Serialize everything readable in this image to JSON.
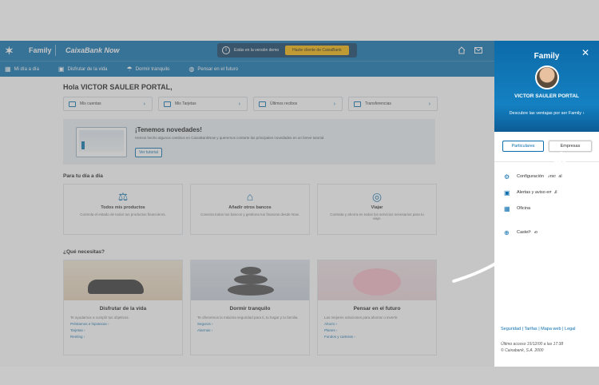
{
  "topbar": {
    "brand_family": "Family",
    "brand_product": "CaixaBank Now",
    "demo_text": "Estás en la versión demo",
    "demo_button": "Hazte cliente de CaixaBank"
  },
  "nav": [
    {
      "label": "Mi día a día",
      "icon": "calendar-icon"
    },
    {
      "label": "Disfrutar de la vida",
      "icon": "suitcase-icon"
    },
    {
      "label": "Dormir tranquilo",
      "icon": "umbrella-icon"
    },
    {
      "label": "Pensar en el futuro",
      "icon": "piggy-icon"
    }
  ],
  "greeting": "Hola VICTOR SAULER PORTAL,",
  "quick_links": [
    {
      "label": "Mis cuentas"
    },
    {
      "label": "Mis Tarjetas"
    },
    {
      "label": "Últimos recibos"
    },
    {
      "label": "Transferencias"
    }
  ],
  "news": {
    "title": "¡Tenemos novedades!",
    "desc": "Hemos hecho algunos cambios en CaixaBankNow y queremos contarte las principales novedades en un breve tutorial.",
    "button": "Ver tutorial"
  },
  "day": {
    "title": "Para tu día a día",
    "cards": [
      {
        "title": "Todos mis productos",
        "desc": "Controla el estado de todos tus productos financieros."
      },
      {
        "title": "Añadir otros bancos",
        "desc": "Conecta todos tus bancos y gestiona tus finanzas desde Now."
      },
      {
        "title": "Viajar",
        "desc": "Contrata y ahorra en todos los servicios necesarios para tu viaje."
      }
    ]
  },
  "needs": {
    "title": "¿Qué necesitas?",
    "items": [
      {
        "title": "Disfrutar de la vida",
        "desc": "Te ayudamos a cumplir tus objetivos.",
        "links": [
          "Préstamos e hipotecas",
          "Tarjetas",
          "Renting"
        ]
      },
      {
        "title": "Dormir tranquilo",
        "desc": "Te ofrecemos la máxima seguridad para ti, tu hogar y tu familia.",
        "links": [
          "Seguros",
          "Alarmas"
        ]
      },
      {
        "title": "Pensar en el futuro",
        "desc": "Las mejores soluciones para ahorrar o invertir.",
        "links": [
          "Ahorro",
          "Planes",
          "Fondos y carteras"
        ]
      }
    ]
  },
  "panel": {
    "title": "Family",
    "name": "VICTOR SAULER PORTAL",
    "desc": "Descubre las ventajas por ser Family",
    "seg_a": "Particulares",
    "seg_b": "Empresas",
    "menu": [
      {
        "label": "Configuración personal",
        "icon": "gear-icon"
      },
      {
        "label": "Alertas y aviso email",
        "icon": "bell-icon"
      },
      {
        "label": "Oficina",
        "icon": "building-icon"
      },
      {
        "label": "Castellano",
        "icon": "globe-icon"
      }
    ],
    "footer_links": "Seguridad | Tarifas | Mapa web | Legal",
    "last_access": "Último acceso 15/12/00 a las 17:38",
    "copyright": "© Caixabank, S.A. 2000"
  }
}
